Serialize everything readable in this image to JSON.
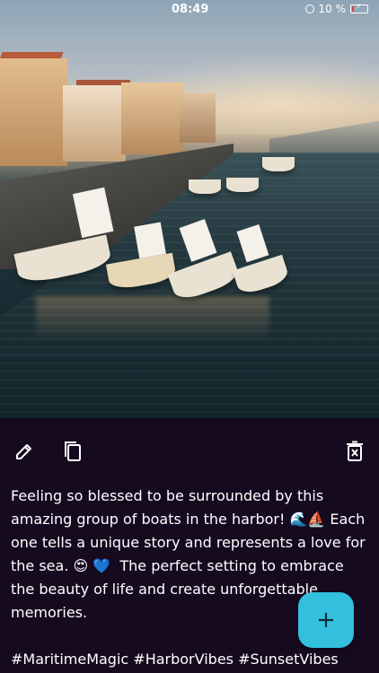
{
  "status_bar": {
    "time": "08:49",
    "battery_text": "10 %",
    "battery_level": 0.1
  },
  "photo": {
    "subject_icon": "harbor-boats-photo"
  },
  "toolbar": {
    "edit_icon": "pencil-icon",
    "copy_icon": "copy-icon",
    "delete_icon": "trash-icon"
  },
  "post": {
    "caption": "Feeling so blessed to be surrounded by this amazing group of boats in the harbor! 🌊⛵ Each one tells a unique story and represents a love for the sea. 😍 💙  The perfect setting to embrace the beauty of life and create unforgettable memories.",
    "hashtags": "#MaritimeMagic #HarborVibes #SunsetVibes"
  },
  "fab": {
    "icon": "plus-icon",
    "label": "+"
  },
  "colors": {
    "background": "#160a1f",
    "fab": "#33c0dc",
    "battery_low": "#e04040"
  }
}
